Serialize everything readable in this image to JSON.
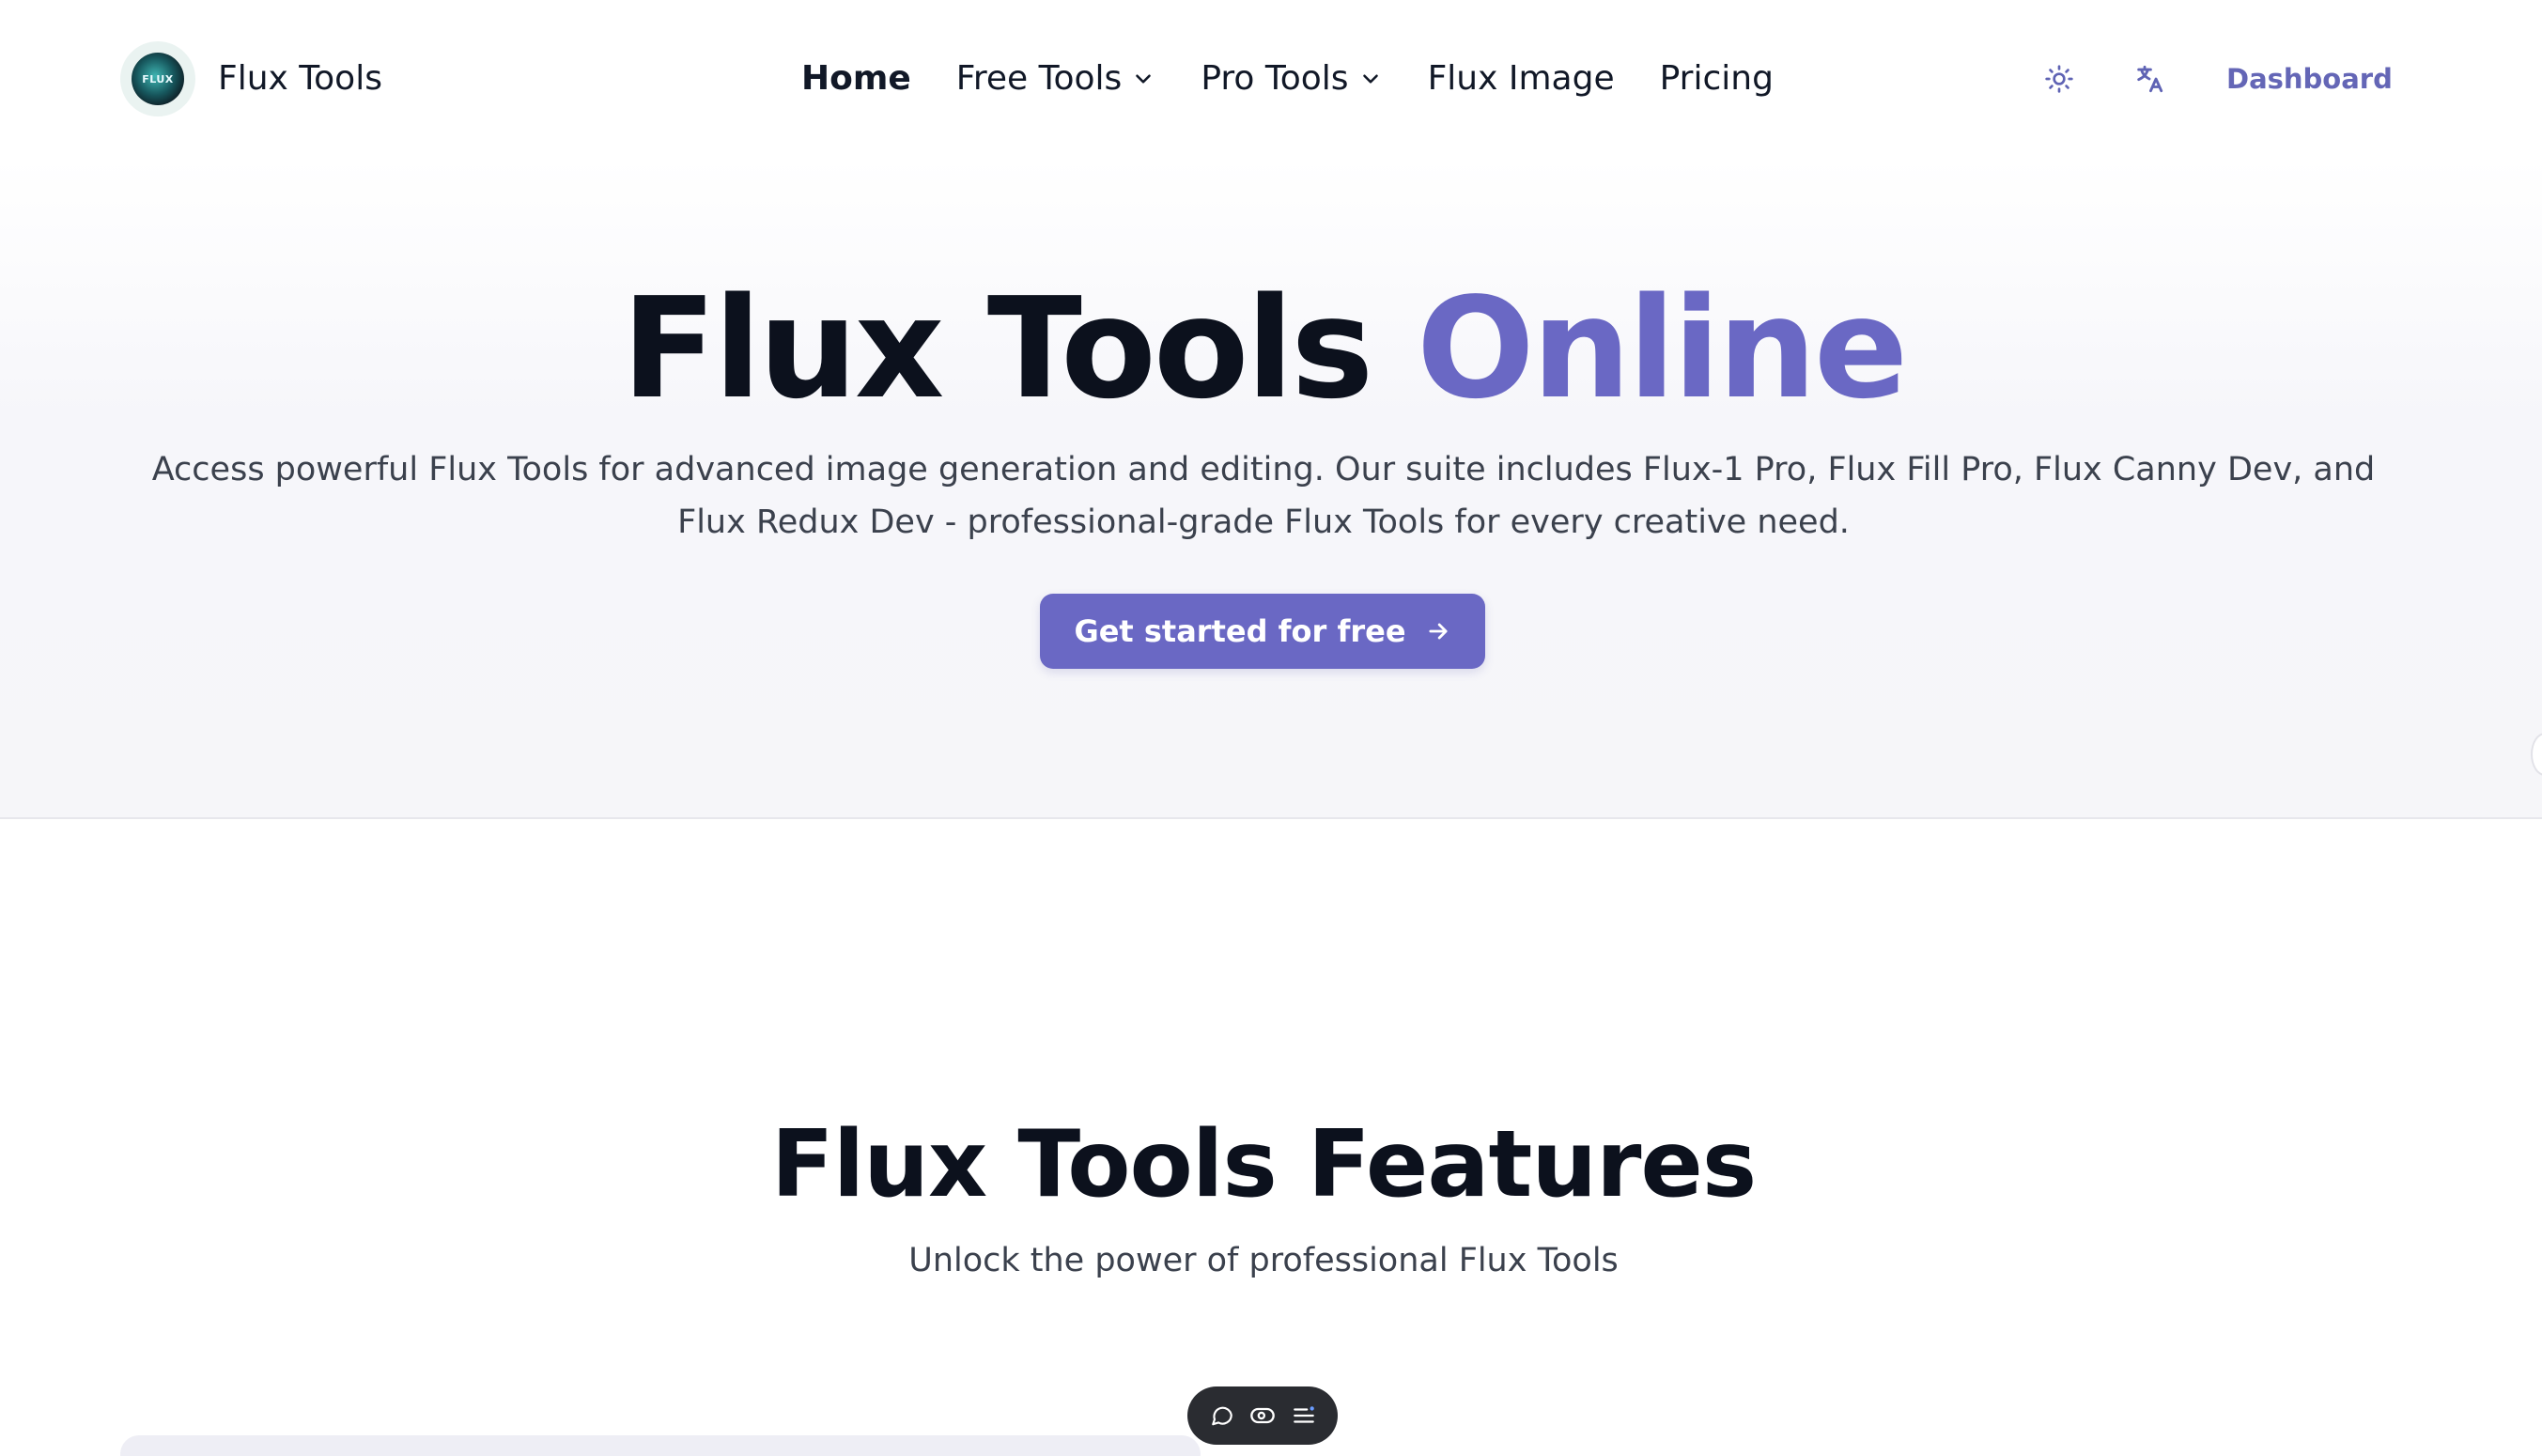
{
  "header": {
    "logo_text": "FLUX",
    "brand": "Flux Tools",
    "nav": [
      {
        "label": "Home",
        "active": true,
        "dropdown": false
      },
      {
        "label": "Free Tools",
        "active": false,
        "dropdown": true
      },
      {
        "label": "Pro Tools",
        "active": false,
        "dropdown": true
      },
      {
        "label": "Flux Image",
        "active": false,
        "dropdown": false
      },
      {
        "label": "Pricing",
        "active": false,
        "dropdown": false
      }
    ],
    "theme_icon": "sun-icon",
    "language_icon": "translate-icon",
    "dashboard_label": "Dashboard"
  },
  "hero": {
    "title_main": "Flux Tools",
    "title_accent": "Online",
    "description": "Access powerful Flux Tools for advanced image generation and editing. Our suite includes Flux-1 Pro, Flux Fill Pro, Flux Canny Dev, and Flux Redux Dev - professional-grade Flux Tools for every creative need.",
    "cta_label": "Get started for free"
  },
  "features": {
    "title": "Flux Tools Features",
    "subtitle": "Unlock the power of professional Flux Tools"
  },
  "floating_toolbar": {
    "icons": [
      "comment-icon",
      "eye-icon",
      "menu-list-icon"
    ]
  },
  "colors": {
    "accent": "#6a68c4",
    "dashboard_text": "#6466b6",
    "toolbar_bg": "#2a2c31",
    "text_dark": "#0c111d",
    "text_muted": "#3b414d"
  }
}
